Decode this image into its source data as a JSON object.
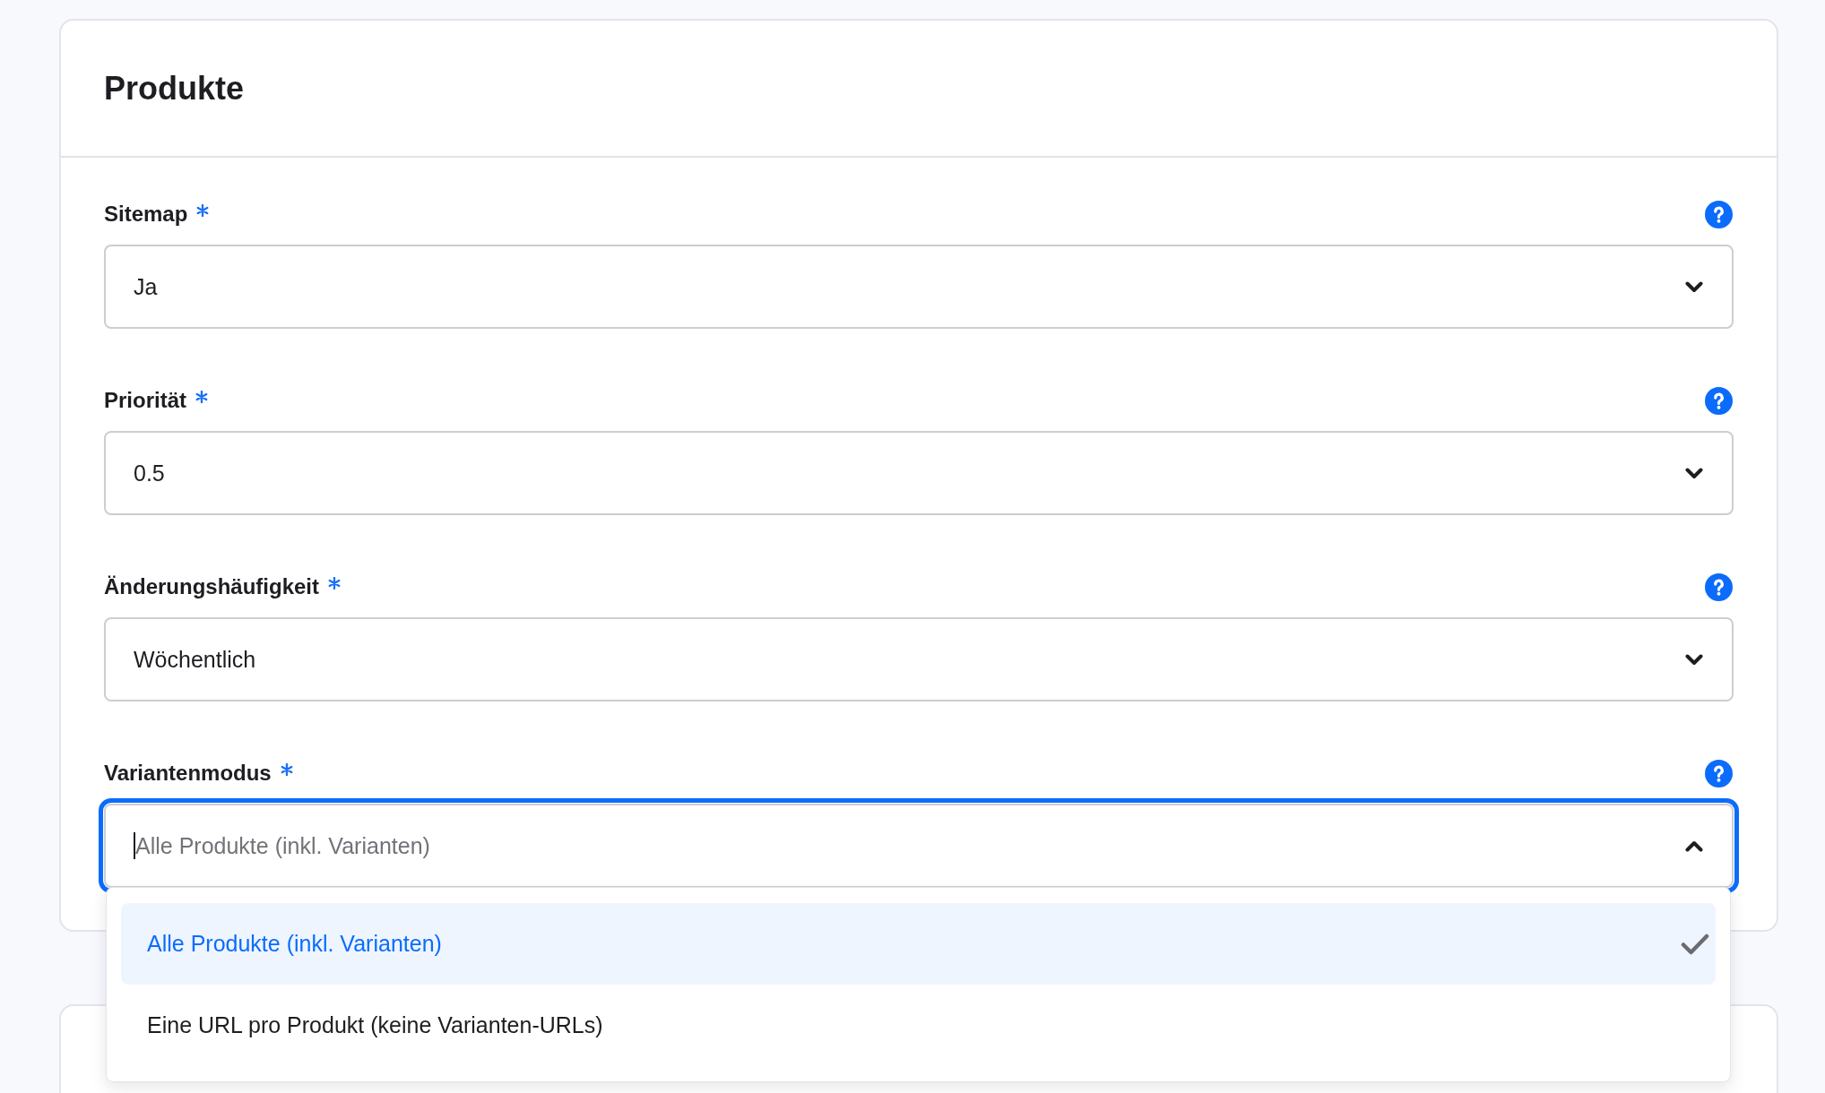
{
  "panel": {
    "title": "Produkte",
    "fields": [
      {
        "label": "Sitemap",
        "required": true,
        "help": true,
        "value": "Ja",
        "focused": false,
        "expanded": false
      },
      {
        "label": "Priorität",
        "required": true,
        "help": true,
        "value": "0.5",
        "focused": false,
        "expanded": false
      },
      {
        "label": "Änderungshäufigkeit",
        "required": true,
        "help": true,
        "value": "Wöchentlich",
        "focused": false,
        "expanded": false
      },
      {
        "label": "Variantenmodus",
        "required": true,
        "help": true,
        "placeholder": "Alle Produkte (inkl. Varianten)",
        "focused": true,
        "expanded": true,
        "options": [
          {
            "label": "Alle Produkte (inkl. Varianten)",
            "selected": true
          },
          {
            "label": "Eine URL pro Produkt (keine Varianten-URLs)",
            "selected": false
          }
        ]
      }
    ]
  }
}
